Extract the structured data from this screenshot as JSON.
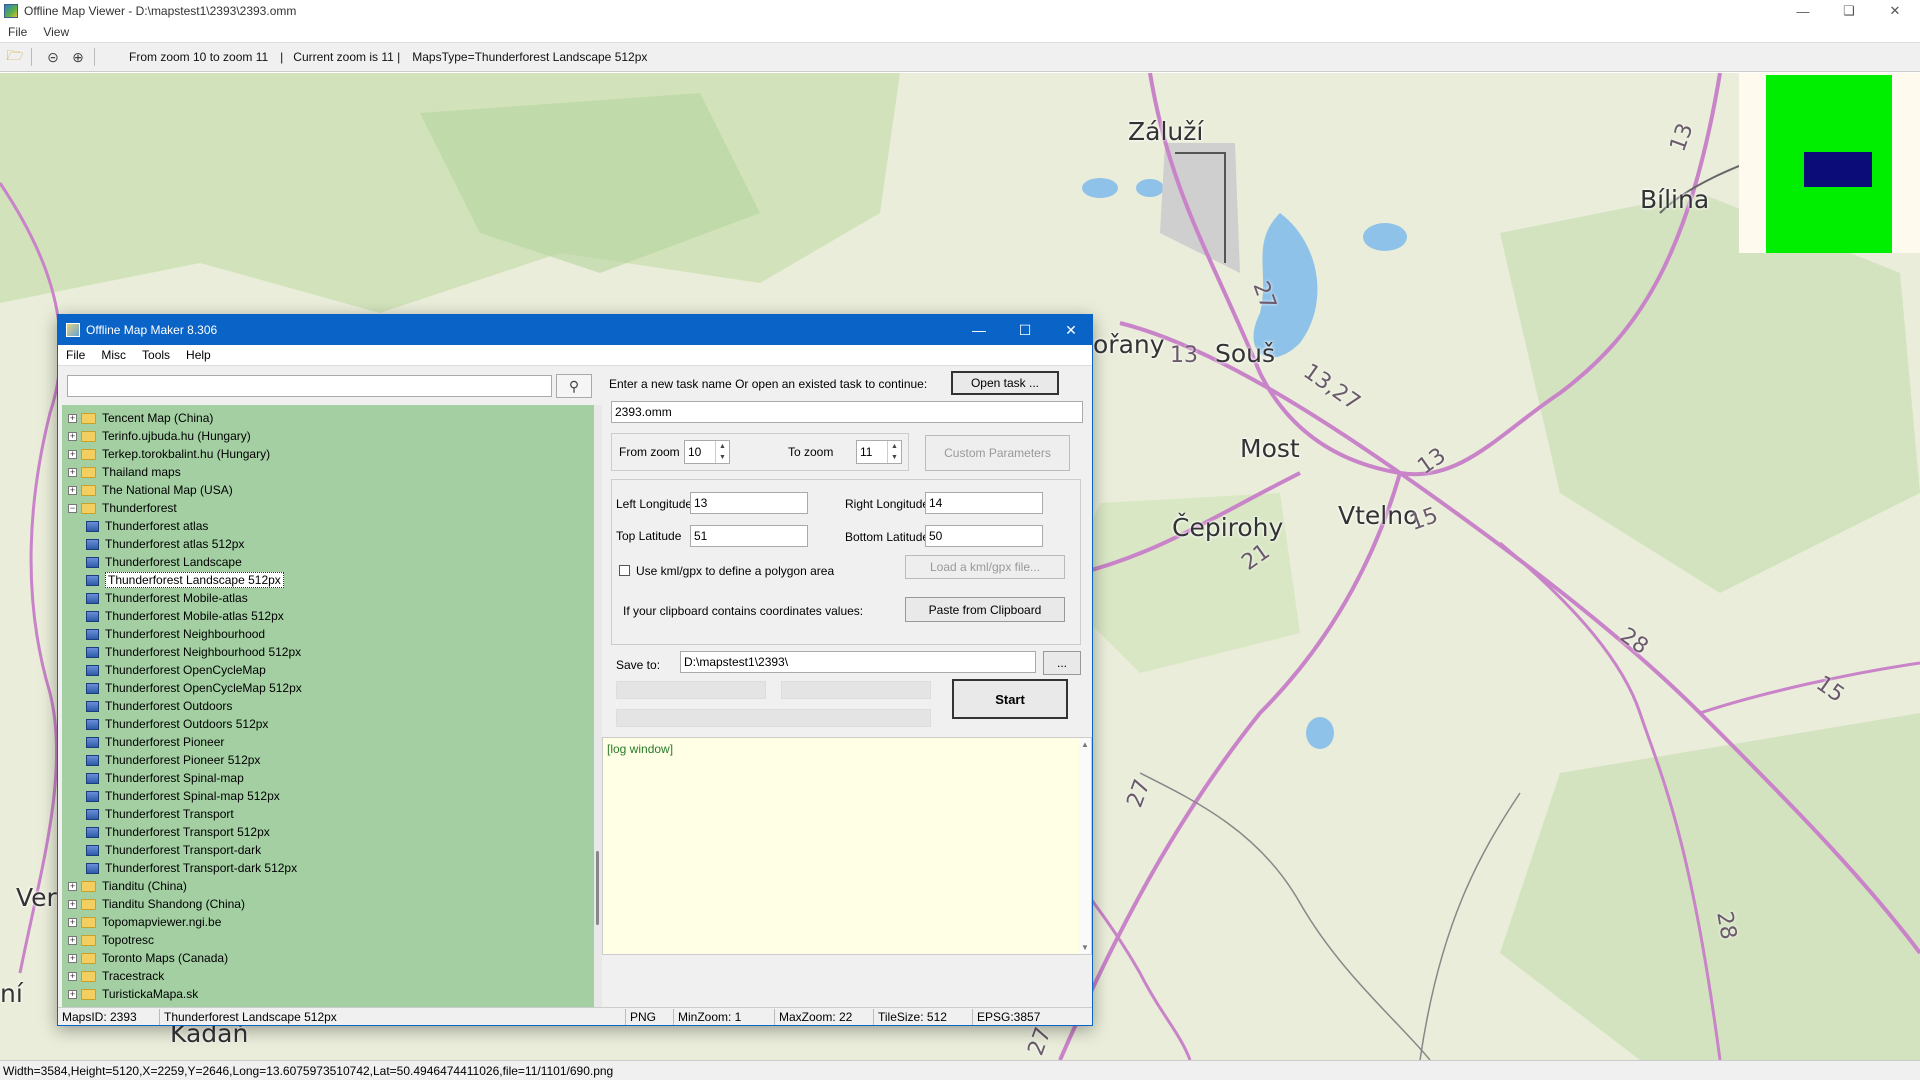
{
  "window": {
    "title": "Offline Map Viewer - D:\\mapstest1\\2393\\2393.omm"
  },
  "menu": [
    "File",
    "View"
  ],
  "toolbar": {
    "zoom_range": "From zoom 10 to zoom 11",
    "current_zoom": "|   Current zoom is 11 |",
    "maps_type": "MapsType=Thunderforest Landscape 512px"
  },
  "map": {
    "places": [
      "Záluží",
      "Bílina",
      "Souš",
      "Most",
      "Vtelno",
      "Čepirohy",
      "ořany",
      "Ver",
      "Kadaň",
      "ní"
    ],
    "roads": [
      "13",
      "27",
      "13",
      "13,27",
      "13",
      "15",
      "21",
      "28",
      "15",
      "27",
      "28",
      "27"
    ],
    "overview_colors": {
      "background": "#fffaee",
      "area": "#00ee00",
      "view": "#0c0c78"
    }
  },
  "statusbar": "Width=3584,Height=5120,X=2259,Y=2646,Long=13.6075973510742,Lat=50.4946474411026,file=11/1101/690.png",
  "dialog": {
    "title": "Offline Map Maker 8.306",
    "menu": [
      "File",
      "Misc",
      "Tools",
      "Help"
    ],
    "search": {
      "value": "",
      "placeholder": ""
    },
    "tree": [
      {
        "label": "Tencent Map (China)",
        "type": "folder",
        "expanded": false
      },
      {
        "label": "Terinfo.ujbuda.hu (Hungary)",
        "type": "folder",
        "expanded": false
      },
      {
        "label": "Terkep.torokbalint.hu (Hungary)",
        "type": "folder",
        "expanded": false
      },
      {
        "label": "Thailand maps",
        "type": "folder",
        "expanded": false
      },
      {
        "label": "The National Map (USA)",
        "type": "folder",
        "expanded": false
      },
      {
        "label": "Thunderforest",
        "type": "folder",
        "expanded": true
      },
      {
        "label": "Thunderforest atlas",
        "type": "map"
      },
      {
        "label": "Thunderforest atlas 512px",
        "type": "map"
      },
      {
        "label": "Thunderforest Landscape",
        "type": "map"
      },
      {
        "label": "Thunderforest Landscape 512px",
        "type": "map",
        "selected": true
      },
      {
        "label": "Thunderforest Mobile-atlas",
        "type": "map"
      },
      {
        "label": "Thunderforest Mobile-atlas 512px",
        "type": "map"
      },
      {
        "label": "Thunderforest Neighbourhood",
        "type": "map"
      },
      {
        "label": "Thunderforest Neighbourhood 512px",
        "type": "map"
      },
      {
        "label": "Thunderforest OpenCycleMap",
        "type": "map"
      },
      {
        "label": "Thunderforest OpenCycleMap 512px",
        "type": "map"
      },
      {
        "label": "Thunderforest Outdoors",
        "type": "map"
      },
      {
        "label": "Thunderforest Outdoors 512px",
        "type": "map"
      },
      {
        "label": "Thunderforest Pioneer",
        "type": "map"
      },
      {
        "label": "Thunderforest Pioneer 512px",
        "type": "map"
      },
      {
        "label": "Thunderforest Spinal-map",
        "type": "map"
      },
      {
        "label": "Thunderforest Spinal-map 512px",
        "type": "map"
      },
      {
        "label": "Thunderforest Transport",
        "type": "map"
      },
      {
        "label": "Thunderforest Transport 512px",
        "type": "map"
      },
      {
        "label": "Thunderforest Transport-dark",
        "type": "map"
      },
      {
        "label": "Thunderforest Transport-dark 512px",
        "type": "map"
      },
      {
        "label": "Tianditu (China)",
        "type": "folder",
        "expanded": false
      },
      {
        "label": "Tianditu Shandong (China)",
        "type": "folder",
        "expanded": false
      },
      {
        "label": "Topomapviewer.ngi.be",
        "type": "folder",
        "expanded": false
      },
      {
        "label": "Topotresc",
        "type": "folder",
        "expanded": false
      },
      {
        "label": "Toronto Maps (Canada)",
        "type": "folder",
        "expanded": false
      },
      {
        "label": "Tracestrack",
        "type": "folder",
        "expanded": false
      },
      {
        "label": "TuristickaMapa.sk",
        "type": "folder",
        "expanded": false
      }
    ],
    "form": {
      "task_prompt": "Enter a new task name Or open an existed task to continue:",
      "open_task": "Open task ...",
      "task_name": "2393.omm",
      "from_zoom_label": "From zoom",
      "from_zoom": "10",
      "to_zoom_label": "To zoom",
      "to_zoom": "11",
      "custom_params": "Custom Parameters",
      "left_lon_label": "Left Longitude",
      "left_lon": "13",
      "right_lon_label": "Right Longitude",
      "right_lon": "14",
      "top_lat_label": "Top Latitude",
      "top_lat": "51",
      "bottom_lat_label": "Bottom Latitude",
      "bottom_lat": "50",
      "kml_check": "Use kml/gpx to define a polygon area",
      "load_kml": "Load a kml/gpx file...",
      "clipboard_label": "If your clipboard contains coordinates values:",
      "paste_btn": "Paste from Clipboard",
      "save_label": "Save to:",
      "save_path": "D:\\mapstest1\\2393\\",
      "browse_btn": "...",
      "start_btn": "Start",
      "log": "[log window]"
    },
    "status": {
      "maps_id": "MapsID: 2393",
      "map_name": "Thunderforest Landscape 512px",
      "format": "PNG",
      "min_zoom": "MinZoom: 1",
      "max_zoom": "MaxZoom: 22",
      "tile_size": "TileSize: 512",
      "epsg": "EPSG:3857"
    }
  }
}
